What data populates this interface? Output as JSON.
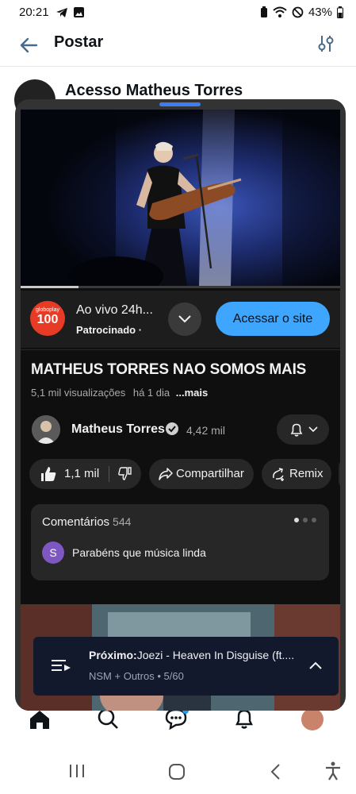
{
  "status_bar": {
    "time": "20:21",
    "battery": "43%"
  },
  "app_bar": {
    "title": "Postar"
  },
  "background_post": {
    "author": "Acesso Matheus Torres"
  },
  "player": {
    "progress_percent": 18
  },
  "ad": {
    "logo_text": "globoplay",
    "logo_number": "100",
    "title": "Ao vivo 24h...",
    "sponsored": "Patrocinado ·",
    "cta": "Acessar o site"
  },
  "video": {
    "title": "MATHEUS TORRES NAO SOMOS MAIS",
    "views": "5,1 mil visualizações",
    "age": "há 1 dia",
    "more": "...mais"
  },
  "channel": {
    "name": "Matheus Torres",
    "subscribers": "4,42 mil"
  },
  "actions": {
    "likes": "1,1 mil",
    "share": "Compartilhar",
    "remix": "Remix"
  },
  "comments": {
    "header": "Comentários",
    "count": "544",
    "avatar_letter": "S",
    "top_comment": "Parabéns que música linda"
  },
  "up_next": {
    "label": "Próximo:",
    "title": "Joezi - Heaven In Disguise (ft....",
    "subtitle": "NSM + Outros • 5/60"
  },
  "colors": {
    "accent_blue": "#3ea6ff",
    "handle_blue": "#3d7cf3",
    "sheet_bg": "#0f0f0f"
  }
}
